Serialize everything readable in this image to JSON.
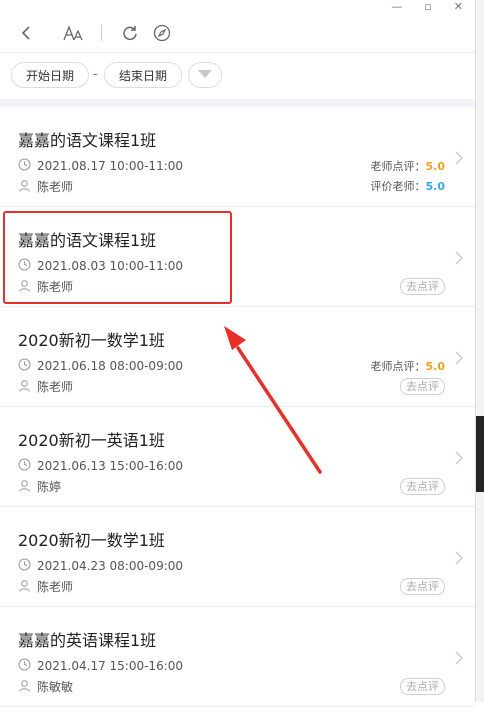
{
  "filters": {
    "start_date": "开始日期",
    "separator": "-",
    "end_date": "结束日期"
  },
  "toolbar": {
    "back_icon": "back-arrow-icon",
    "font_icon": "font-size-icon",
    "refresh_icon": "refresh-icon",
    "compass_icon": "compass-icon"
  },
  "courses": [
    {
      "title": "嘉嘉的语文课程1班",
      "time": "2021.08.17 10:00-11:00",
      "teacher": "陈老师",
      "rating_label": "老师点评：",
      "rating_score": "5.0",
      "eval_label": "评价老师：",
      "eval_score": "5.0",
      "action": ""
    },
    {
      "title": "嘉嘉的语文课程1班",
      "time": "2021.08.03 10:00-11:00",
      "teacher": "陈老师",
      "rating_label": "",
      "rating_score": "",
      "eval_label": "",
      "eval_score": "",
      "action": "去点评"
    },
    {
      "title": "2020新初一数学1班",
      "time": "2021.06.18 08:00-09:00",
      "teacher": "陈老师",
      "rating_label": "老师点评：",
      "rating_score": "5.0",
      "eval_label": "",
      "eval_score": "",
      "action": "去点评"
    },
    {
      "title": "2020新初一英语1班",
      "time": "2021.06.13 15:00-16:00",
      "teacher": "陈婷",
      "rating_label": "",
      "rating_score": "",
      "eval_label": "",
      "eval_score": "",
      "action": "去点评"
    },
    {
      "title": "2020新初一数学1班",
      "time": "2021.04.23 08:00-09:00",
      "teacher": "陈老师",
      "rating_label": "",
      "rating_score": "",
      "eval_label": "",
      "eval_score": "",
      "action": "去点评"
    },
    {
      "title": "嘉嘉的英语课程1班",
      "time": "2021.04.17 15:00-16:00",
      "teacher": "陈敏敏",
      "rating_label": "",
      "rating_score": "",
      "eval_label": "",
      "eval_score": "",
      "action": "去点评"
    }
  ],
  "colors": {
    "highlight": "#e8302a",
    "score_orange": "#f0a020",
    "score_blue": "#3aa8e8"
  }
}
